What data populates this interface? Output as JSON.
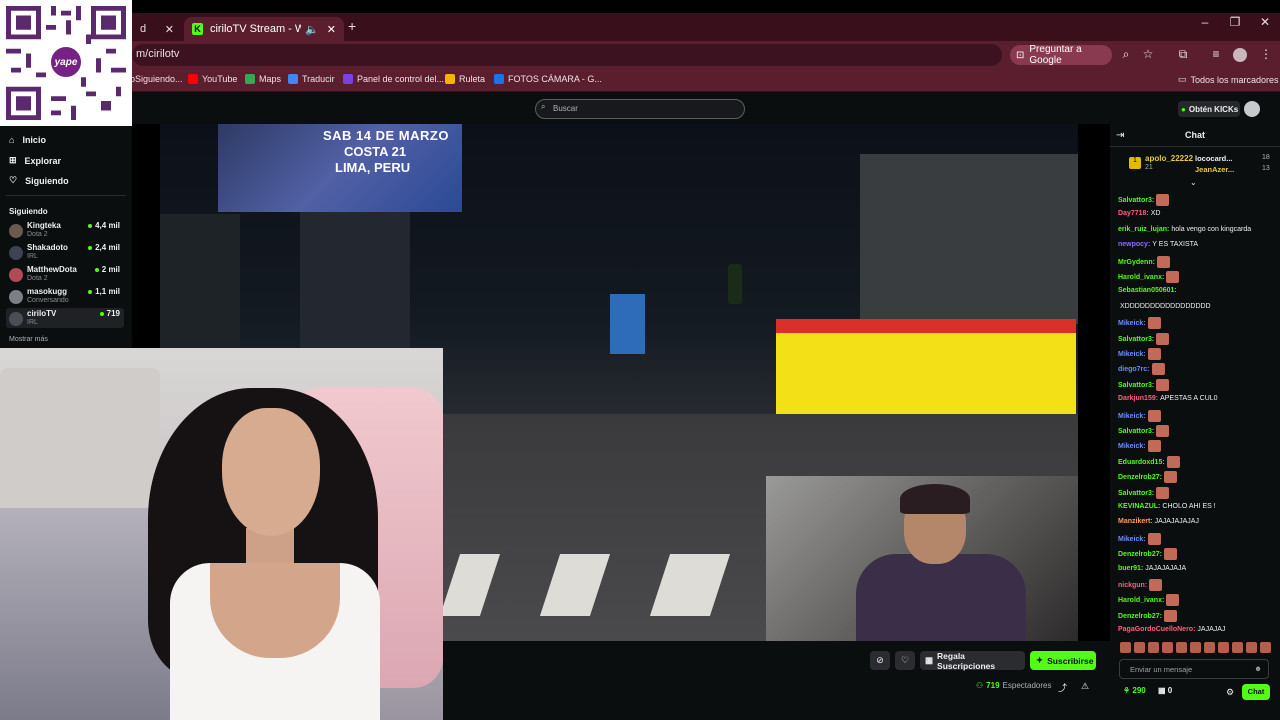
{
  "browser": {
    "tabs": [
      {
        "label": "d"
      },
      {
        "label": "ciriloTV Stream - Watch Liv"
      }
    ],
    "new_tab": "+",
    "window_controls": [
      "–",
      "❐",
      "✕"
    ],
    "url": "m/cirilotv",
    "google_button": "Preguntar a Google",
    "bookmarks": [
      {
        "label": "oSiguiendo...",
        "color": "#e65c00"
      },
      {
        "label": "YouTube",
        "color": "#ff0000"
      },
      {
        "label": "Maps",
        "color": "#34a853"
      },
      {
        "label": "Traducir",
        "color": "#4285f4"
      },
      {
        "label": "Panel de control del...",
        "color": "#7b3fe4"
      },
      {
        "label": "Ruleta",
        "color": "#f5b400"
      },
      {
        "label": "FOTOS CÁMARA - G...",
        "color": "#1a73e8"
      }
    ],
    "all_bookmarks": "Todos los marcadores"
  },
  "header": {
    "search_placeholder": "Buscar",
    "kicks_button": "Obtén KICKs"
  },
  "qr": {
    "brand": "yape"
  },
  "sidebar": {
    "nav": [
      {
        "label": "Inicio",
        "icon": "home-icon"
      },
      {
        "label": "Explorar",
        "icon": "compass-icon"
      },
      {
        "label": "Siguiendo",
        "icon": "heart-icon"
      }
    ],
    "following_title": "Siguiendo",
    "following": [
      {
        "name": "Kingteka",
        "category": "Dota 2",
        "viewers": "4,4 mil",
        "avatar_color": "#6b5a4e"
      },
      {
        "name": "Shakadoto",
        "category": "IRL",
        "viewers": "2,4 mil",
        "avatar_color": "#3e4451"
      },
      {
        "name": "MatthewDota",
        "category": "Dota 2",
        "viewers": "2 mil",
        "avatar_color": "#b04b56"
      },
      {
        "name": "masokugg",
        "category": "Conversando",
        "viewers": "1,1 mil",
        "avatar_color": "#7b7f86"
      },
      {
        "name": "ciriloTV",
        "category": "IRL",
        "viewers": "719",
        "avatar_color": "#4b4f55"
      }
    ],
    "more": "Mostrar más"
  },
  "stream": {
    "billboard": {
      "line1": "SAB 14 DE MARZO",
      "line2": "COSTA 21",
      "line3": "LIMA, PERU"
    }
  },
  "controls": {
    "gift_label": "Regala Suscripciones",
    "subscribe_label": "Suscribirse",
    "viewer_count": "719",
    "viewer_label": "Espectadores"
  },
  "chat": {
    "title": "Chat",
    "leaderboard": [
      {
        "name": "apolo_22222",
        "count": "21"
      },
      {
        "name": "lococard...",
        "count": "18"
      },
      {
        "name": "JeanAzer...",
        "count": "13"
      }
    ],
    "messages": [
      {
        "user": "Salvattor3:",
        "text": "",
        "color": "#53fc18",
        "emote": true
      },
      {
        "user": "Day7718:",
        "text": "XD",
        "color": "#ff5e7e",
        "emote": false
      },
      {
        "user": "erik_ruiz_lujan:",
        "text": "hola vengo con kingcarda",
        "color": "#53fc18",
        "emote": false
      },
      {
        "user": "newpocy:",
        "text": "Y ES TAXISTA",
        "color": "#8b6bff",
        "emote": false
      },
      {
        "user": "MrGydenn:",
        "text": "",
        "color": "#53fc18",
        "emote": true
      },
      {
        "user": "Harold_ivanx:",
        "text": "",
        "color": "#53fc18",
        "emote": true
      },
      {
        "user": "Sebastian050601:",
        "text": "",
        "color": "#53fc18",
        "emote": false
      },
      {
        "user": "",
        "text": "XDDDDDDDDDDDDDDDDD",
        "color": "#efeff1",
        "emote": false
      },
      {
        "user": "Mikeick:",
        "text": "",
        "color": "#6c8cff",
        "emote": true
      },
      {
        "user": "Salvattor3:",
        "text": "",
        "color": "#53fc18",
        "emote": true
      },
      {
        "user": "Mikeick:",
        "text": "",
        "color": "#6c8cff",
        "emote": true
      },
      {
        "user": "diego7rc:",
        "text": "",
        "color": "#6c8cff",
        "emote": true
      },
      {
        "user": "Salvattor3:",
        "text": "",
        "color": "#53fc18",
        "emote": true
      },
      {
        "user": "Darkjun159:",
        "text": "APESTAS A CUL0",
        "color": "#ff5e7e",
        "emote": false
      },
      {
        "user": "Mikeick:",
        "text": "",
        "color": "#6c8cff",
        "emote": true
      },
      {
        "user": "Salvattor3:",
        "text": "",
        "color": "#53fc18",
        "emote": true
      },
      {
        "user": "Mikeick:",
        "text": "",
        "color": "#6c8cff",
        "emote": true
      },
      {
        "user": "Eduardoxd15:",
        "text": "",
        "color": "#53fc18",
        "emote": true
      },
      {
        "user": "Denzelrob27:",
        "text": "",
        "color": "#53fc18",
        "emote": true
      },
      {
        "user": "Salvattor3:",
        "text": "",
        "color": "#53fc18",
        "emote": true
      },
      {
        "user": "KEVINAZUL:",
        "text": "CHOLO AHI ES !",
        "color": "#53fc18",
        "emote": false
      },
      {
        "user": "Manzikert:",
        "text": "JAJAJAJAJAJ",
        "color": "#ff9a5e",
        "emote": false
      },
      {
        "user": "Mikeick:",
        "text": "",
        "color": "#6c8cff",
        "emote": true
      },
      {
        "user": "Denzelrob27:",
        "text": "",
        "color": "#53fc18",
        "emote": true
      },
      {
        "user": "buer91:",
        "text": "JAJAJAJAJA",
        "color": "#53fc18",
        "emote": false
      },
      {
        "user": "nickgun:",
        "text": "",
        "color": "#ff5e7e",
        "emote": true
      },
      {
        "user": "Harold_ivanx:",
        "text": "",
        "color": "#53fc18",
        "emote": true
      },
      {
        "user": "Denzelrob27:",
        "text": "",
        "color": "#53fc18",
        "emote": true
      },
      {
        "user": "PagaGordoCuelloNero:",
        "text": "JAJAJAJ",
        "color": "#ff5e7e",
        "emote": false
      }
    ],
    "input_placeholder": "Enviar un mensaje",
    "points": "290",
    "gifts": "0",
    "send_label": "Chat"
  }
}
